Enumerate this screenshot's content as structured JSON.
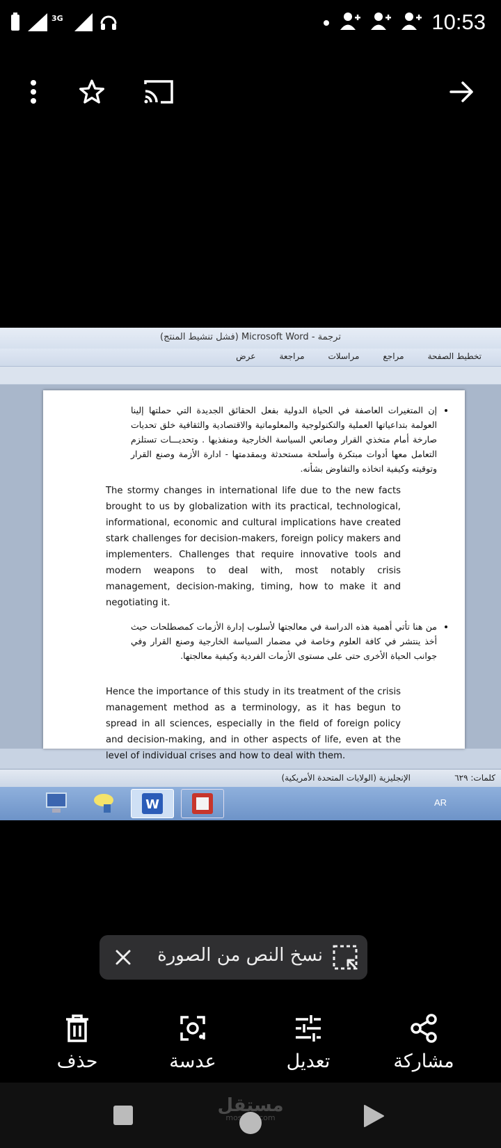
{
  "status_bar": {
    "network": "3G",
    "time": "10:53",
    "icons": [
      "battery-icon",
      "signal-icon",
      "headset-icon",
      "dot-icon",
      "person-add-icon",
      "person-add-icon",
      "person-add-icon"
    ]
  },
  "top_bar": {
    "icons": [
      "more-vertical-icon",
      "star-icon",
      "cast-icon",
      "arrow-right-icon"
    ]
  },
  "photo": {
    "window_title": "ترجمة - Microsoft Word (فشل تنشيط المنتج)",
    "ribbon_tabs": [
      "تخطيط الصفحة",
      "مراجع",
      "مراسلات",
      "مراجعة",
      "عرض"
    ],
    "arabic_paragraph_1": "إن المتغيرات العاصفة في الحياة الدولية بفعل الحقائق الجديدة التي حملتها إلينا العولمة بتداعياتها العملية والتكنولوجية والمعلوماتية والاقتصادية والثقافية خلق تحديات صارخة أمام متخذي القرار وصانعي السياسة الخارجية ومنفذيها . وتحديـــات تستلزم التعامل معها أدوات مبتكرة وأسلحة مستحدثة وبمقدمتها - ادارة الأزمة وصنع القرار وتوقيته وكيفية اتخاذه والتفاوض بشأنه.",
    "english_paragraph_1": "The stormy changes in international life due to the new facts brought to us by globalization with its practical, technological, informational, economic and cultural implications have created stark challenges for decision-makers, foreign policy makers and implementers. Challenges that require innovative tools and modern weapons to deal with, most notably crisis management, decision-making, timing, how to make it and negotiating it.",
    "arabic_paragraph_2": "من هنا تأتي أهمية هذه الدراسة في معالجتها لأسلوب إدارة الأزمات كمصطلحات حيث أخذ ينتشر في كافة العلوم وخاصة في مضمار السياسة الخارجية وصنع القرار وفي جوانب الحياة الأخرى حتى على مستوى الأزمات الفردية وكيفية معالجتها.",
    "english_paragraph_2": "Hence the importance of this study in its treatment of the crisis management method as a terminology, as it has begun to spread in all sciences, especially in the field of foreign policy and decision-making, and in other aspects of life, even at the level of individual crises and how to deal with them.",
    "status_words": "كلمات: ٦٢٩",
    "status_language": "الإنجليزية (الولايات المتحدة الأمريكية)",
    "taskbar_lang": "AR"
  },
  "copy_chip": {
    "label": "نسخ النص من الصورة"
  },
  "actions": [
    {
      "label": "مشاركة",
      "icon": "share-icon"
    },
    {
      "label": "تعديل",
      "icon": "sliders-icon"
    },
    {
      "label": "عدسة",
      "icon": "lens-icon"
    },
    {
      "label": "حذف",
      "icon": "trash-icon"
    }
  ],
  "watermark": {
    "arabic": "مستقل",
    "english": "mostaql.com"
  }
}
